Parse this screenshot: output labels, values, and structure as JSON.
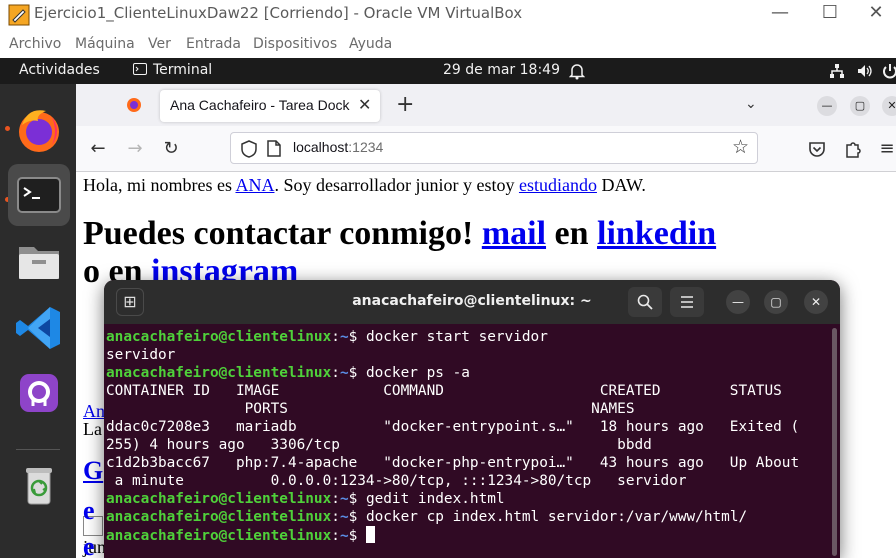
{
  "vbox": {
    "title": "Ejercicio1_ClienteLinuxDaw22 [Corriendo] - Oracle VM VirtualBox",
    "menu": [
      "Archivo",
      "Máquina",
      "Ver",
      "Entrada",
      "Dispositivos",
      "Ayuda"
    ],
    "buttons": {
      "minimize": "—",
      "maximize": "☐",
      "close": "✕"
    }
  },
  "topbar": {
    "activities": "Actividades",
    "app": "Terminal",
    "clock": "29 de mar  18:49"
  },
  "dock": {
    "items": [
      "firefox-icon",
      "terminal-icon",
      "files-icon",
      "vscode-icon",
      "github-desktop-icon",
      "trash-icon"
    ]
  },
  "firefox": {
    "tab_title": "Ana Cachafeiro - Tarea Docker",
    "tab_close": "✕",
    "new_tab": "+",
    "list_tabs": "⌄",
    "url_host": "localhost",
    "url_port": ":1234",
    "window_buttons": {
      "minimize": "—",
      "maximize": "▢",
      "close": "✕"
    }
  },
  "page": {
    "intro_before": "Hola, mi nombres es ",
    "intro_link1": "ANA",
    "intro_middle": ". Soy desarrollador junior y estoy ",
    "intro_link2": "estudiando",
    "intro_after": " DAW.",
    "contact_before": "Puedes contactar conmigo! ",
    "contact_mail": "mail",
    "contact_en": " en ",
    "contact_linkedin": "linkedin",
    "contact_o_en": "o en ",
    "contact_instagram": "instagram",
    "frag_an": "An",
    "frag_la": "La",
    "frag_g": "G",
    "frag_jun": "jun",
    "frag_e1": "e",
    "frag_e2": "e"
  },
  "terminal": {
    "title": "anacachafeiro@clientelinux: ~",
    "prompt_user": "anacachafeiro@clientelinux",
    "prompt_path": "~",
    "prompt_symbol": "$ ",
    "lines": [
      {
        "type": "cmd",
        "text": "docker start servidor"
      },
      {
        "type": "out",
        "text": "servidor"
      },
      {
        "type": "cmd",
        "text": "docker ps -a"
      },
      {
        "type": "out",
        "text": "CONTAINER ID   IMAGE            COMMAND                  CREATED        STATUS"
      },
      {
        "type": "out",
        "text": "                PORTS                                   NAMES"
      },
      {
        "type": "out",
        "text": "ddac0c7208e3   mariadb          \"docker-entrypoint.s…\"   18 hours ago   Exited ("
      },
      {
        "type": "out",
        "text": "255) 4 hours ago   3306/tcp                                bbdd"
      },
      {
        "type": "out",
        "text": "c1d2b3bacc67   php:7.4-apache   \"docker-php-entrypoi…\"   43 hours ago   Up About"
      },
      {
        "type": "out",
        "text": " a minute          0.0.0.0:1234->80/tcp, :::1234->80/tcp   servidor"
      },
      {
        "type": "cmd",
        "text": "gedit index.html"
      },
      {
        "type": "cmd",
        "text": "docker cp index.html servidor:/var/www/html/"
      },
      {
        "type": "cmd-cursor",
        "text": ""
      }
    ]
  }
}
